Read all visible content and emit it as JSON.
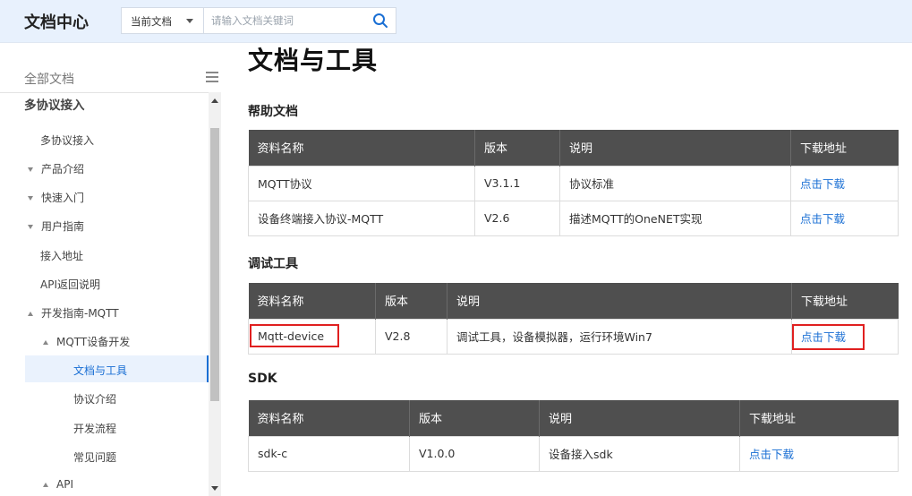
{
  "header": {
    "logo": "文档中心",
    "search_scope": "当前文档",
    "search_placeholder": "请输入文档关键词"
  },
  "sidebar": {
    "heading": "全部文档",
    "section": "多协议接入",
    "items": [
      {
        "label": "多协议接入",
        "toggle": "none"
      },
      {
        "label": "产品介绍",
        "toggle": "collapsed"
      },
      {
        "label": "快速入门",
        "toggle": "collapsed"
      },
      {
        "label": "用户指南",
        "toggle": "collapsed"
      },
      {
        "label": "接入地址",
        "toggle": "none"
      },
      {
        "label": "API返回说明",
        "toggle": "none"
      },
      {
        "label": "开发指南-MQTT",
        "toggle": "expanded"
      },
      {
        "label": "MQTT设备开发",
        "toggle": "expanded"
      },
      {
        "label": "文档与工具",
        "toggle": "none",
        "active": true
      },
      {
        "label": "协议介绍",
        "toggle": "none"
      },
      {
        "label": "开发流程",
        "toggle": "none"
      },
      {
        "label": "常见问题",
        "toggle": "none"
      },
      {
        "label": "API",
        "toggle": "expanded"
      }
    ]
  },
  "main": {
    "title": "文档与工具",
    "sections": [
      {
        "title": "帮助文档",
        "headers": [
          "资料名称",
          "版本",
          "说明",
          "下载地址"
        ],
        "rows": [
          {
            "name": "MQTT协议",
            "version": "V3.1.1",
            "desc": "协议标准",
            "link": "点击下载"
          },
          {
            "name": "设备终端接入协议-MQTT",
            "version": "V2.6",
            "desc": "描述MQTT的OneNET实现",
            "link": "点击下载"
          }
        ]
      },
      {
        "title": "调试工具",
        "headers": [
          "资料名称",
          "版本",
          "说明",
          "下载地址"
        ],
        "rows": [
          {
            "name": "Mqtt-device",
            "version": "V2.8",
            "desc": "调试工具，设备模拟器，运行环境Win7",
            "link": "点击下载"
          }
        ]
      },
      {
        "title": "SDK",
        "headers": [
          "资料名称",
          "版本",
          "说明",
          "下载地址"
        ],
        "rows": [
          {
            "name": "sdk-c",
            "version": "V1.0.0",
            "desc": "设备接入sdk",
            "link": "点击下载"
          }
        ]
      }
    ]
  },
  "colors": {
    "header_bg": "#e8f1fd",
    "table_header_bg": "#4f4f4f",
    "link": "#1a6fd4",
    "highlight": "#e02020",
    "active_item_bg": "#eaf2fd"
  }
}
